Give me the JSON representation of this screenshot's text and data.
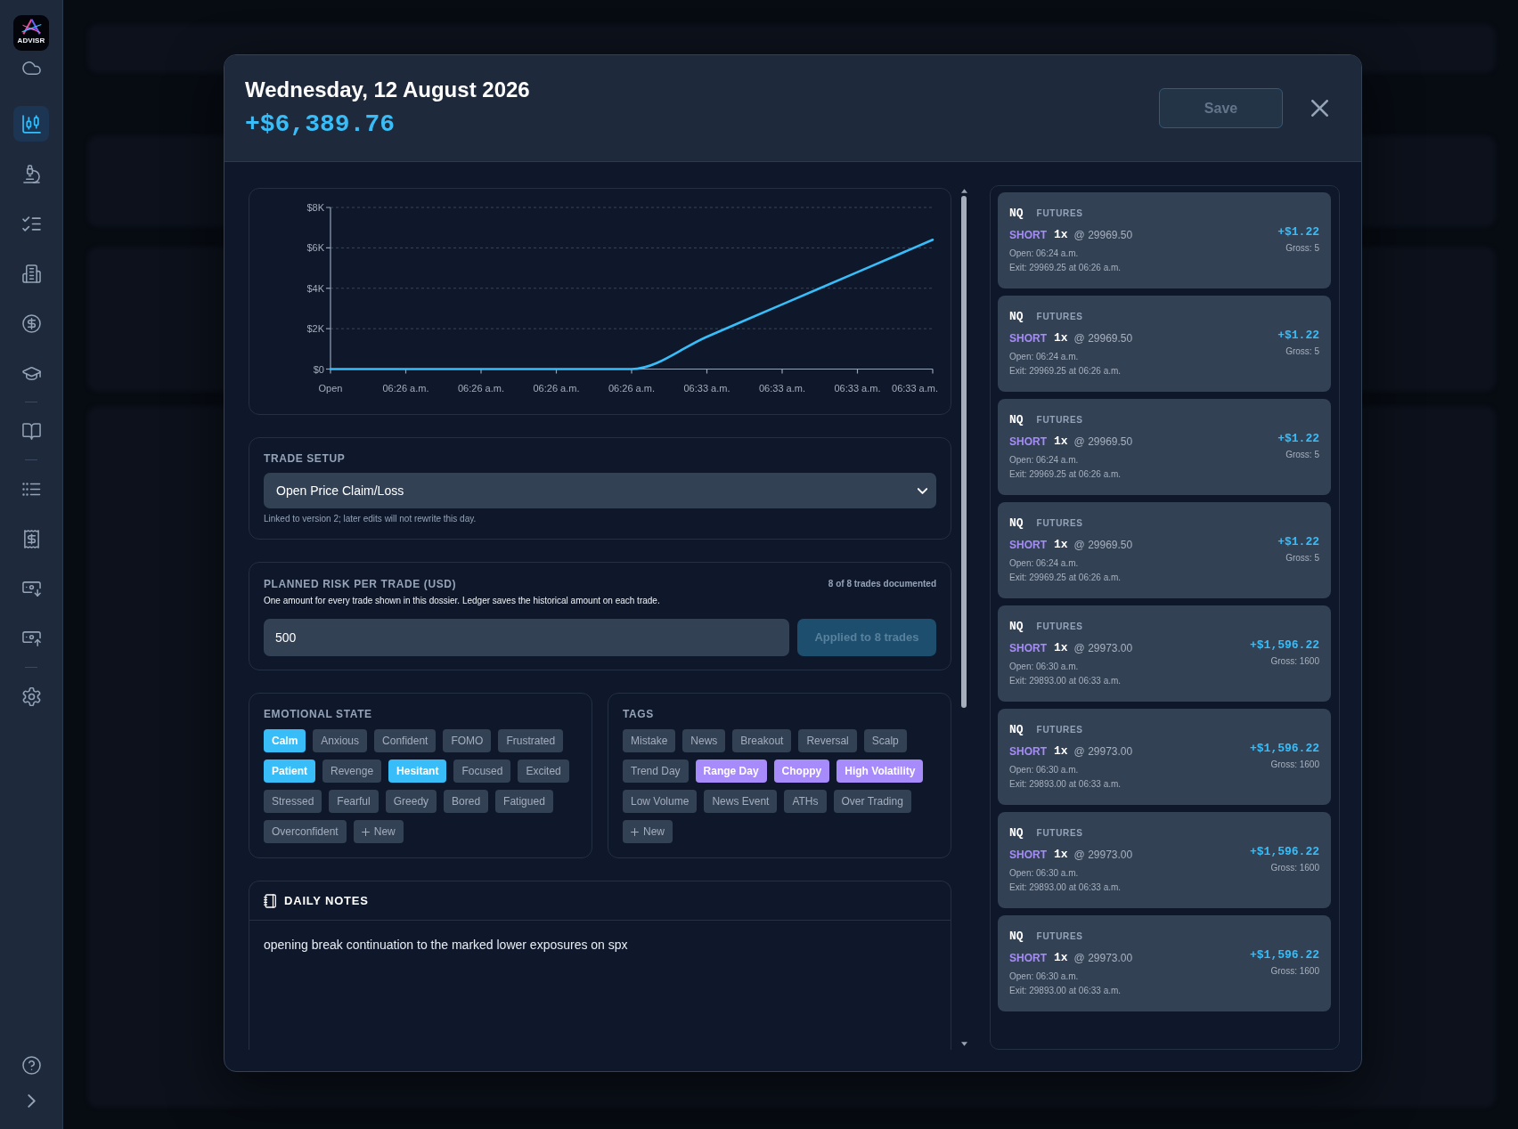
{
  "sidebar": {
    "logo": "ADVISR",
    "groups": [
      {
        "items": [
          {
            "kind": "cloud",
            "selected": false
          },
          {
            "kind": "candlestick",
            "selected": true
          },
          {
            "kind": "microscope",
            "selected": false
          },
          {
            "kind": "checklist",
            "selected": false
          },
          {
            "kind": "building",
            "selected": false
          },
          {
            "kind": "dollar",
            "selected": false
          },
          {
            "kind": "graduation",
            "selected": false
          }
        ]
      },
      {
        "items": [
          {
            "kind": "book",
            "selected": false
          }
        ]
      },
      {
        "items": [
          {
            "kind": "list",
            "selected": false
          },
          {
            "kind": "receipt",
            "selected": false
          },
          {
            "kind": "cash_in",
            "selected": false
          },
          {
            "kind": "cash_out",
            "selected": false
          }
        ]
      },
      {
        "items": [
          {
            "kind": "settings",
            "selected": false
          }
        ]
      }
    ],
    "footer": [
      {
        "kind": "help"
      },
      {
        "kind": "expand"
      }
    ]
  },
  "dialog": {
    "title": "Wednesday, 12 August 2026",
    "total": "+$6,389.76",
    "save_button": {
      "label": "Save",
      "disabled": true
    },
    "chart": {
      "chart_data": {
        "type": "line",
        "grid": true,
        "categories": [
          "Open",
          "06:26 a.m.",
          "06:26 a.m.",
          "06:26 a.m.",
          "06:26 a.m.",
          "06:33 a.m.",
          "06:33 a.m.",
          "06:33 a.m.",
          "06:33 a.m."
        ],
        "series": [
          {
            "color": "#38bdf8",
            "values": [
              0,
              0,
              0,
              0,
              0,
              1600,
              3200,
              4800,
              6400
            ]
          }
        ],
        "ylim": [
          0,
          8000
        ],
        "yticks": [
          {
            "value": 0,
            "label": "$0"
          },
          {
            "value": 2000,
            "label": "$2K"
          },
          {
            "value": 4000,
            "label": "$4K"
          },
          {
            "value": 6000,
            "label": "$6K"
          },
          {
            "value": 8000,
            "label": "$8K"
          }
        ]
      }
    },
    "trade_setup": {
      "label": "TRADE SETUP",
      "value": "Open Price Claim/Loss",
      "hint": "Linked to version 2; later edits will not rewrite this day."
    },
    "planned_risk": {
      "label": "PLANNED RISK PER TRADE (USD)",
      "status": "8 of 8 trades documented",
      "description": "One amount for every trade shown in this dossier. Ledger saves the historical amount on each trade.",
      "value": "500",
      "apply_button": {
        "label": "Applied to 8 trades",
        "disabled": true
      }
    },
    "emotional_state": {
      "label": "EMOTIONAL STATE",
      "options": [
        {
          "label": "Calm",
          "selected": true
        },
        {
          "label": "Anxious",
          "selected": false
        },
        {
          "label": "Confident",
          "selected": false
        },
        {
          "label": "FOMO",
          "selected": false
        },
        {
          "label": "Frustrated",
          "selected": false
        },
        {
          "label": "Patient",
          "selected": true
        },
        {
          "label": "Revenge",
          "selected": false
        },
        {
          "label": "Hesitant",
          "selected": true
        },
        {
          "label": "Focused",
          "selected": false
        },
        {
          "label": "Excited",
          "selected": false
        },
        {
          "label": "Stressed",
          "selected": false
        },
        {
          "label": "Fearful",
          "selected": false
        },
        {
          "label": "Greedy",
          "selected": false
        },
        {
          "label": "Bored",
          "selected": false
        },
        {
          "label": "Fatigued",
          "selected": false
        },
        {
          "label": "Overconfident",
          "selected": false
        }
      ],
      "add_button": "New"
    },
    "tags": {
      "label": "TAGS",
      "options": [
        {
          "label": "Mistake",
          "selected": false
        },
        {
          "label": "News",
          "selected": false
        },
        {
          "label": "Breakout",
          "selected": false
        },
        {
          "label": "Reversal",
          "selected": false
        },
        {
          "label": "Scalp",
          "selected": false
        },
        {
          "label": "Trend Day",
          "selected": false
        },
        {
          "label": "Range Day",
          "selected": true
        },
        {
          "label": "Choppy",
          "selected": true
        },
        {
          "label": "High Volatility",
          "selected": true
        },
        {
          "label": "Low Volume",
          "selected": false
        },
        {
          "label": "News Event",
          "selected": false
        },
        {
          "label": "ATHs",
          "selected": false
        },
        {
          "label": "Over Trading",
          "selected": false
        }
      ],
      "add_button": "New"
    },
    "daily_notes": {
      "title": "DAILY NOTES",
      "text": "opening break continuation to the marked lower exposures on spx"
    },
    "trades": [
      {
        "symbol": "NQ",
        "type": "FUTURES",
        "side": "SHORT",
        "quantity": "1x",
        "entry": "@ 29969.50",
        "open": "Open: 06:24 a.m.",
        "exit": "Exit: 29969.25 at 06:26 a.m.",
        "pnl": "+$1.22",
        "gross": "Gross: 5"
      },
      {
        "symbol": "NQ",
        "type": "FUTURES",
        "side": "SHORT",
        "quantity": "1x",
        "entry": "@ 29969.50",
        "open": "Open: 06:24 a.m.",
        "exit": "Exit: 29969.25 at 06:26 a.m.",
        "pnl": "+$1.22",
        "gross": "Gross: 5"
      },
      {
        "symbol": "NQ",
        "type": "FUTURES",
        "side": "SHORT",
        "quantity": "1x",
        "entry": "@ 29969.50",
        "open": "Open: 06:24 a.m.",
        "exit": "Exit: 29969.25 at 06:26 a.m.",
        "pnl": "+$1.22",
        "gross": "Gross: 5"
      },
      {
        "symbol": "NQ",
        "type": "FUTURES",
        "side": "SHORT",
        "quantity": "1x",
        "entry": "@ 29969.50",
        "open": "Open: 06:24 a.m.",
        "exit": "Exit: 29969.25 at 06:26 a.m.",
        "pnl": "+$1.22",
        "gross": "Gross: 5"
      },
      {
        "symbol": "NQ",
        "type": "FUTURES",
        "side": "SHORT",
        "quantity": "1x",
        "entry": "@ 29973.00",
        "open": "Open: 06:30 a.m.",
        "exit": "Exit: 29893.00 at 06:33 a.m.",
        "pnl": "+$1,596.22",
        "gross": "Gross: 1600"
      },
      {
        "symbol": "NQ",
        "type": "FUTURES",
        "side": "SHORT",
        "quantity": "1x",
        "entry": "@ 29973.00",
        "open": "Open: 06:30 a.m.",
        "exit": "Exit: 29893.00 at 06:33 a.m.",
        "pnl": "+$1,596.22",
        "gross": "Gross: 1600"
      },
      {
        "symbol": "NQ",
        "type": "FUTURES",
        "side": "SHORT",
        "quantity": "1x",
        "entry": "@ 29973.00",
        "open": "Open: 06:30 a.m.",
        "exit": "Exit: 29893.00 at 06:33 a.m.",
        "pnl": "+$1,596.22",
        "gross": "Gross: 1600"
      },
      {
        "symbol": "NQ",
        "type": "FUTURES",
        "side": "SHORT",
        "quantity": "1x",
        "entry": "@ 29973.00",
        "open": "Open: 06:30 a.m.",
        "exit": "Exit: 29893.00 at 06:33 a.m.",
        "pnl": "+$1,596.22",
        "gross": "Gross: 1600"
      }
    ]
  }
}
